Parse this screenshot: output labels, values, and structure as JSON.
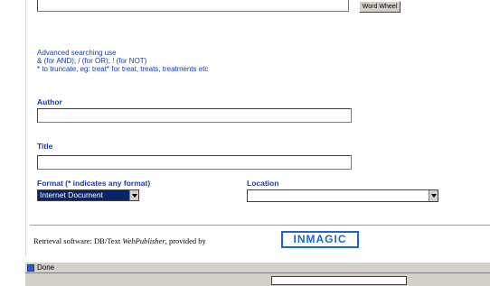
{
  "search": {
    "word_wheel_label": "Word Wheel"
  },
  "help": {
    "line1": "Advanced searching use",
    "line2": "& (for AND); / (for OR); ! (for NOT)",
    "line3": "* to truncate, eg: treat* for treat, treats, treatments etc"
  },
  "author": {
    "label": "Author",
    "value": ""
  },
  "title_field": {
    "label": "Title",
    "value": ""
  },
  "format": {
    "label": "Format (* indicates any format)",
    "selected": "Internet Document"
  },
  "location": {
    "label": "Location",
    "selected": ""
  },
  "footer": {
    "retrieval_prefix": "Retrieval software: DB/Text ",
    "product": "WebPublisher",
    "suffix": ", provided by",
    "logo_text": "INMAGIC"
  },
  "status": {
    "text": "Done"
  }
}
